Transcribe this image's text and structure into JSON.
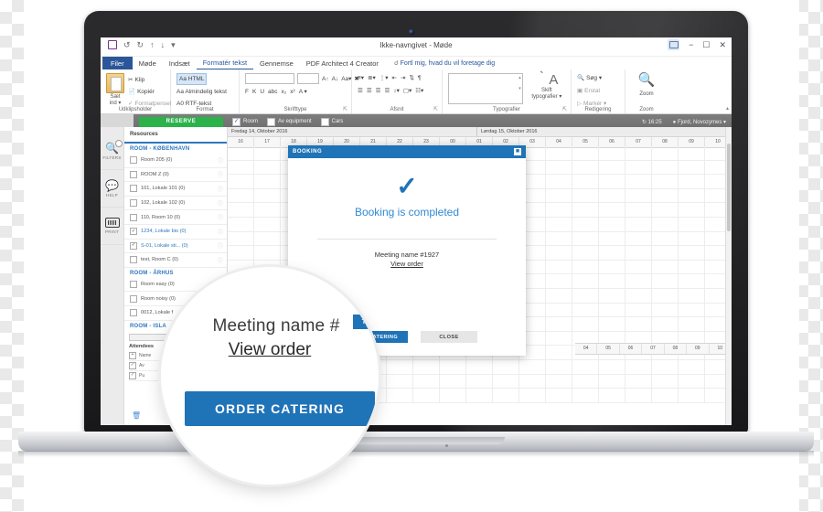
{
  "office": {
    "window_title": "Ikke-navngivet - Møde",
    "qat": [
      "save-icon",
      "undo-icon",
      "redo-icon",
      "up-icon",
      "down-icon",
      "more-icon"
    ],
    "window_controls": [
      "ribbon-display-options",
      "minimize",
      "restore",
      "close"
    ],
    "tabs": [
      {
        "label": "Filer",
        "state": "file"
      },
      {
        "label": "Møde",
        "state": "normal"
      },
      {
        "label": "Indsæt",
        "state": "normal"
      },
      {
        "label": "Formatér tekst",
        "state": "active"
      },
      {
        "label": "Gennemse",
        "state": "normal"
      },
      {
        "label": "PDF Architect 4 Creator",
        "state": "normal"
      }
    ],
    "tell_me": "Fortl mig, hvad du vil foretage dig",
    "ribbon_groups": [
      {
        "label": "Udklipsholder",
        "items": [
          "Sæt ind ▾",
          "Klip",
          "Kopiér",
          "Formatpensel"
        ]
      },
      {
        "label": "Format",
        "items": [
          "Aa HTML",
          "Aa Almindelig tekst",
          "A0 RTF-tekst"
        ]
      },
      {
        "label": "Skrifttype",
        "items": [
          "F",
          "K",
          "U",
          "abc",
          "x₂",
          "x²",
          "A ▾",
          "Aᴬ",
          "Aᴬ",
          "Aa ▾"
        ]
      },
      {
        "label": "Afsnit",
        "items": [
          "bullets",
          "numbering",
          "multilevel",
          "indent-decrease",
          "indent-increase",
          "sort",
          "paragraph-mark",
          "align-left",
          "align-center",
          "align-right",
          "justify",
          "line-spacing",
          "shading",
          "borders"
        ]
      },
      {
        "label": "Typografier",
        "items": [
          "Skift typografier ▾"
        ]
      },
      {
        "label": "Redigering",
        "items": [
          "Søg ▾",
          "Erstat",
          "Markér ▾"
        ]
      },
      {
        "label": "Zoom",
        "items": [
          "Zoom"
        ]
      }
    ]
  },
  "appbar": {
    "reserve_label": "RESERVE",
    "filters": [
      {
        "label": "Room",
        "checked": true
      },
      {
        "label": "Av equipment",
        "checked": false
      },
      {
        "label": "Cars",
        "checked": false
      }
    ],
    "clock": "16:25",
    "user": "Fjord, Novozymes ▾"
  },
  "rail": [
    {
      "label": "FILTERS",
      "icon": "filter-search-icon",
      "badge": true
    },
    {
      "label": "HELP",
      "icon": "help-people-icon",
      "badge": false
    },
    {
      "label": "PRINT",
      "icon": "print-icon",
      "badge": false
    }
  ],
  "resources": {
    "header": "Resources",
    "groups": [
      {
        "title": "ROOM - KØBENHAVN",
        "rows": [
          {
            "label": "Room 205 (0)",
            "checked": false,
            "selected": false
          },
          {
            "label": "ROOM Z (0)",
            "checked": false,
            "selected": false
          },
          {
            "label": "101, Lokale 101 (0)",
            "checked": false,
            "selected": false
          },
          {
            "label": "102, Lokale 102 (0)",
            "checked": false,
            "selected": false
          },
          {
            "label": "110, Room 10 (0)",
            "checked": false,
            "selected": false
          },
          {
            "label": "1234, Lokale bio (0)",
            "checked": true,
            "selected": true
          },
          {
            "label": "S-01, Lokale sti... (0)",
            "checked": true,
            "selected": true
          },
          {
            "label": "test, Room C (0)",
            "checked": false,
            "selected": false
          }
        ]
      },
      {
        "title": "ROOM - ÅRHUS",
        "rows": [
          {
            "label": "Room easy (0)",
            "checked": false,
            "selected": false
          },
          {
            "label": "Room noisy (0)",
            "checked": false,
            "selected": false
          },
          {
            "label": "0012, Lokale f",
            "checked": false,
            "selected": false
          }
        ]
      },
      {
        "title": "ROOM - ISLA",
        "rows": []
      }
    ],
    "attendees_title": "Attendees",
    "attendees_column": "Name",
    "attendees": [
      {
        "label": "Av",
        "checked": true
      },
      {
        "label": "Pu",
        "checked": true
      }
    ],
    "trash_icon": "trash-icon"
  },
  "schedule": {
    "days": [
      "Fredag 14, Oktober 2016",
      "Lørdag 15, Oktober 2016"
    ],
    "hours": [
      "16",
      "17",
      "18",
      "19",
      "20",
      "21",
      "22",
      "23",
      "00",
      "01",
      "02",
      "03",
      "04",
      "05",
      "06",
      "07",
      "08",
      "09",
      "10"
    ],
    "lower_hours": [
      "04",
      "05",
      "06",
      "07",
      "08",
      "09",
      "10"
    ]
  },
  "modal": {
    "title": "BOOKING",
    "close_icon": "close-icon",
    "check_icon": "check-icon",
    "message": "Booking is completed",
    "meeting_name": "Meeting name #1927",
    "view_order": "View order",
    "primary_button": "ORDER CATERING",
    "secondary_button": "CLOSE"
  },
  "loupe": {
    "meeting_name": "Meeting name #",
    "view_order": "View order",
    "button": "ORDER CATERING",
    "chip": "TERING"
  },
  "colors": {
    "office_blue": "#2b579a",
    "accent_blue": "#1f73b7",
    "link_blue": "#2f77c0",
    "green": "#2bb34a",
    "gray_bar": "#6f6f6f"
  }
}
